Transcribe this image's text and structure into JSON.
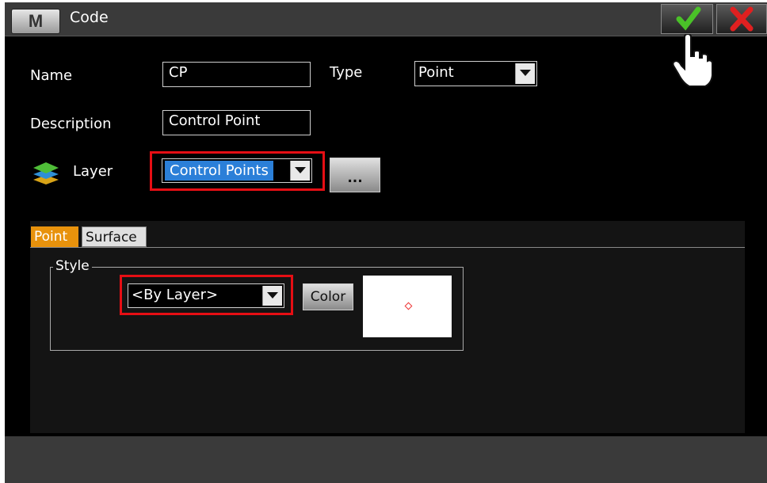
{
  "window": {
    "menu_button": "M",
    "title": "Code"
  },
  "form": {
    "name_label": "Name",
    "name_value": "CP",
    "type_label": "Type",
    "type_value": "Point",
    "description_label": "Description",
    "description_value": "Control Point",
    "layer_label": "Layer",
    "layer_value": "Control Points",
    "browse_label": "..."
  },
  "tabs": [
    {
      "label": "Point",
      "active": true
    },
    {
      "label": "Surface",
      "active": false
    }
  ],
  "style_group": {
    "title": "Style",
    "style_value": "<By Layer>",
    "color_button": "Color"
  },
  "colors": {
    "highlight": "#e60e14",
    "active_tab": "#e8920c",
    "selection": "#2b7fd8",
    "ok_check": "#4ac128",
    "cancel_x": "#e02020"
  },
  "icons": [
    "check-icon",
    "close-icon",
    "layers-icon",
    "hand-cursor-icon",
    "dropdown-arrow-icon"
  ]
}
